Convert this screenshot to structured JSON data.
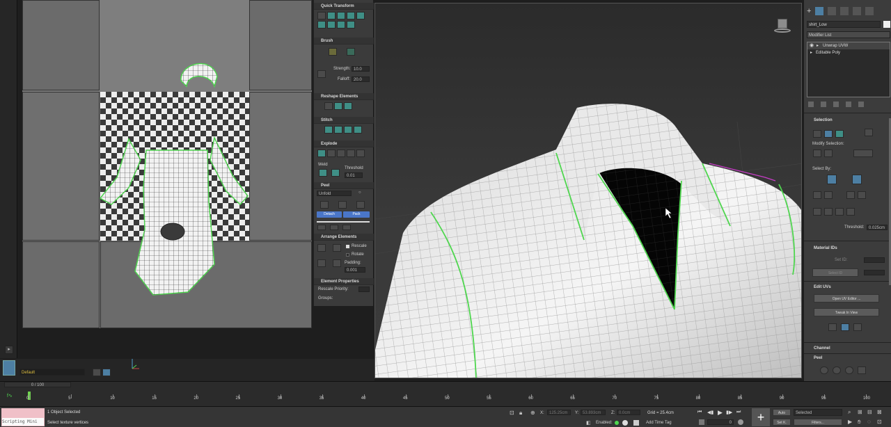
{
  "uv_panel": {
    "quick_transform": "Quick Transform",
    "brush": "Brush",
    "strength_label": "Strength:",
    "strength_value": "10.0",
    "falloff_label": "Falloff:",
    "falloff_value": "20.0",
    "reshape_elements": "Reshape Elements",
    "stitch": "Stitch",
    "explode": "Explode",
    "weld": "Weld",
    "threshold_label": "Threshold",
    "threshold_value": "0.01",
    "peel": "Peel",
    "unfold": "Unfold",
    "detach": "Detach",
    "pack": "Pack",
    "arrange_elements": "Arrange Elements",
    "rescale": "Rescale",
    "rotate": "Rotate",
    "padding_label": "Padding:",
    "padding_value": "0.001",
    "element_properties": "Element Properties",
    "rescale_priority": "Rescale Priority:",
    "groups": "Groups:"
  },
  "right_panel": {
    "object_name": "shirt_Low",
    "modifier_list": "Modifier List",
    "stack": [
      "Unwrap UVW",
      "Editable Poly"
    ],
    "selection": "Selection",
    "modify_selection": "Modify Selection:",
    "select_by": "Select By:",
    "threshold_label": "Threshold:",
    "threshold_value": "0.025cm",
    "material_ids": "Material IDs",
    "set_id": "Set ID:",
    "select_id": "Select ID",
    "edit_uvs": "Edit UVs",
    "open_uv_editor": "Open UV Editor ...",
    "tweak_in_view": "Tweak In View",
    "channel": "Channel",
    "peel": "Peel"
  },
  "bottom": {
    "layer": "Default",
    "frame_counter": "0 / 100",
    "ticks": [
      "0",
      "5",
      "10",
      "15",
      "20",
      "25",
      "30",
      "35",
      "40",
      "45",
      "50",
      "55",
      "60",
      "65",
      "70",
      "75",
      "80",
      "85",
      "90",
      "95",
      "100"
    ],
    "status_selected": "1 Object Selected",
    "status_hint": "Select texture vertices",
    "scripting": "Scripting Mini",
    "x_label": "X:",
    "x_value": "125.25cm",
    "y_label": "Y:",
    "y_value": "53.893cm",
    "z_label": "Z:",
    "z_value": "0.0cm",
    "grid": "Grid = 25.4cm",
    "enabled": "Enabled:",
    "add_time_tag": "Add Time Tag",
    "auto": "Auto",
    "selected": "Selected",
    "set_k": "Set K.",
    "filters": "Filters...",
    "frame_field": "0"
  },
  "colors": {
    "seam_green": "#4fd64f",
    "accent_blue": "#4a76c8",
    "checker_dark": "#3a3a3a"
  }
}
